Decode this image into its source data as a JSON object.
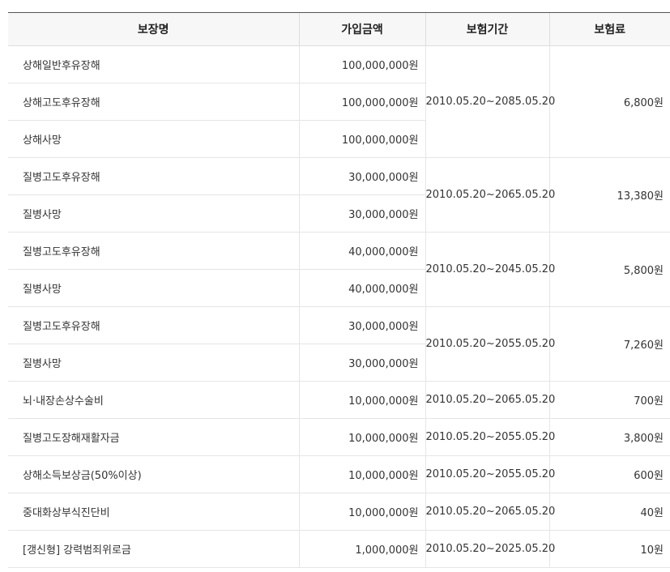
{
  "headers": {
    "name": "보장명",
    "amount": "가입금액",
    "period": "보험기간",
    "premium": "보험료"
  },
  "rows": [
    {
      "name": "상해일반후유장해",
      "amount": "100,000,000원"
    },
    {
      "name": "상해고도후유장해",
      "amount": "100,000,000원"
    },
    {
      "name": "상해사망",
      "amount": "100,000,000원"
    },
    {
      "name": "질병고도후유장해",
      "amount": "30,000,000원"
    },
    {
      "name": "질병사망",
      "amount": "30,000,000원"
    },
    {
      "name": "질병고도후유장해",
      "amount": "40,000,000원"
    },
    {
      "name": "질병사망",
      "amount": "40,000,000원"
    },
    {
      "name": "질병고도후유장해",
      "amount": "30,000,000원"
    },
    {
      "name": "질병사망",
      "amount": "30,000,000원"
    },
    {
      "name": "뇌·내장손상수술비",
      "amount": "10,000,000원"
    },
    {
      "name": "질병고도장해재활자금",
      "amount": "10,000,000원"
    },
    {
      "name": "상해소득보상금(50%이상)",
      "amount": "10,000,000원"
    },
    {
      "name": "중대화상부식진단비",
      "amount": "10,000,000원"
    },
    {
      "name": "[갱신형] 강력범죄위로금",
      "amount": "1,000,000원"
    }
  ],
  "groups": [
    {
      "period": "2010.05.20~2085.05.20",
      "premium": "6,800원"
    },
    {
      "period": "2010.05.20~2065.05.20",
      "premium": "13,380원"
    },
    {
      "period": "2010.05.20~2045.05.20",
      "premium": "5,800원"
    },
    {
      "period": "2010.05.20~2055.05.20",
      "premium": "7,260원"
    },
    {
      "period": "2010.05.20~2065.05.20",
      "premium": "700원"
    },
    {
      "period": "2010.05.20~2055.05.20",
      "premium": "3,800원"
    },
    {
      "period": "2010.05.20~2055.05.20",
      "premium": "600원"
    },
    {
      "period": "2010.05.20~2065.05.20",
      "premium": "40원"
    },
    {
      "period": "2010.05.20~2025.05.20",
      "premium": "10원"
    }
  ]
}
